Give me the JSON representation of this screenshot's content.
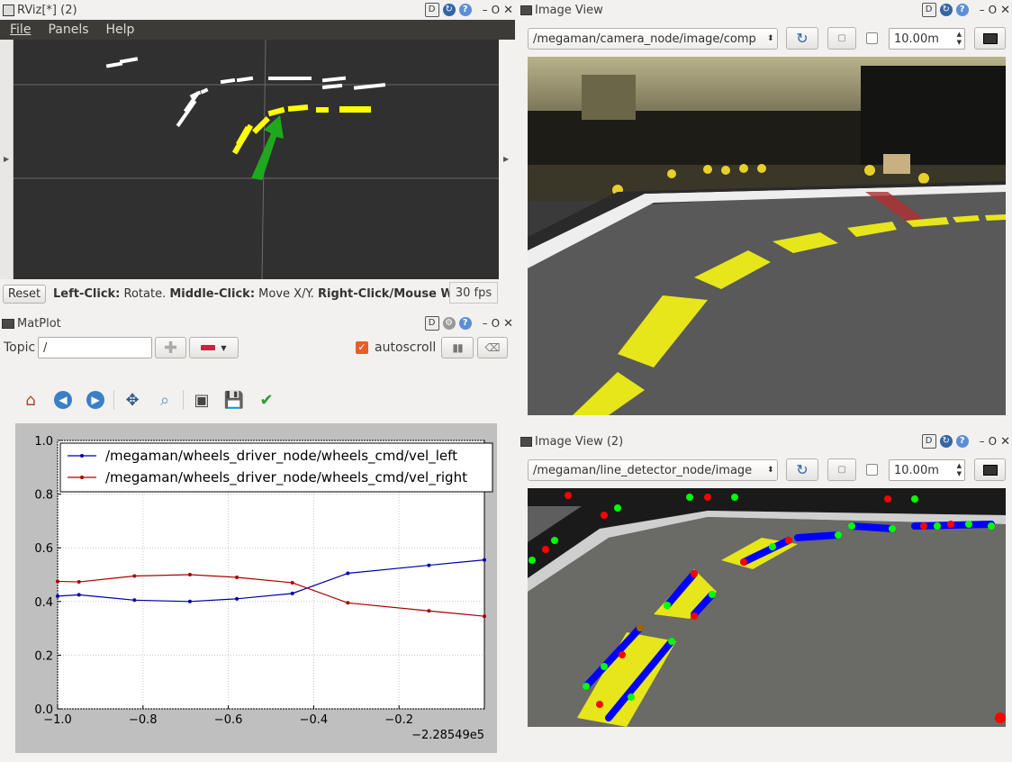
{
  "rviz": {
    "title": "RViz[*] (2)",
    "menu": [
      "File",
      "Panels",
      "Help"
    ],
    "reset_label": "Reset",
    "status_bold1": "Left-Click:",
    "status_text1": " Rotate. ",
    "status_bold2": "Middle-Click:",
    "status_text2": " Move X/Y. ",
    "status_bold3": "Right-Click/Mouse W",
    "fps": "30 fps"
  },
  "image_view_1": {
    "title": "Image View",
    "topic": "/megaman/camera_node/image/comp",
    "distance": "10.00m"
  },
  "image_view_2": {
    "title": "Image View (2)",
    "topic": "/megaman/line_detector_node/image",
    "distance": "10.00m"
  },
  "matplot": {
    "title": "MatPlot",
    "topic_label": "Topic",
    "topic_value": "/",
    "autoscroll_label": "autoscroll",
    "accent": "#e85d2a"
  },
  "chart_data": {
    "type": "line",
    "x_offset_label": "−2.28549e5",
    "xlim": [
      -1.0,
      0.0
    ],
    "ylim": [
      0.0,
      1.0
    ],
    "x_ticks": [
      "−1.0",
      "−0.8",
      "−0.6",
      "−0.4",
      "−0.2"
    ],
    "x_tick_values": [
      -1.0,
      -0.8,
      -0.6,
      -0.4,
      -0.2
    ],
    "y_ticks": [
      "0.0",
      "0.2",
      "0.4",
      "0.6",
      "0.8",
      "1.0"
    ],
    "y_tick_values": [
      0.0,
      0.2,
      0.4,
      0.6,
      0.8,
      1.0
    ],
    "grid": true,
    "legend_position": "top-left",
    "series": [
      {
        "name": "/megaman/wheels_driver_node/wheels_cmd/vel_left",
        "color": "#0000aa",
        "x": [
          -1.0,
          -0.95,
          -0.82,
          -0.69,
          -0.58,
          -0.45,
          -0.32,
          -0.13,
          0.0
        ],
        "y": [
          0.42,
          0.425,
          0.405,
          0.4,
          0.41,
          0.43,
          0.505,
          0.535,
          0.555
        ]
      },
      {
        "name": "/megaman/wheels_driver_node/wheels_cmd/vel_right",
        "color": "#aa0000",
        "x": [
          -1.0,
          -0.95,
          -0.82,
          -0.69,
          -0.58,
          -0.45,
          -0.32,
          -0.13,
          0.0
        ],
        "y": [
          0.475,
          0.473,
          0.495,
          0.5,
          0.49,
          0.47,
          0.395,
          0.365,
          0.345
        ]
      }
    ]
  }
}
